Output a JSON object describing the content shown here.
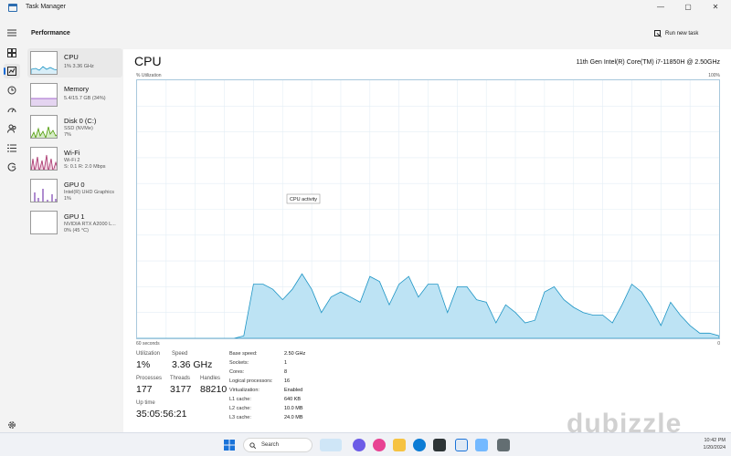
{
  "window": {
    "title": "Task Manager",
    "minimize_glyph": "—",
    "maximize_glyph": "▢",
    "close_glyph": "✕"
  },
  "header": {
    "page_title": "Performance",
    "run_task_label": "Run new task",
    "more_label": "···"
  },
  "devices": [
    {
      "name": "CPU",
      "sub1": "1% 3.36 GHz",
      "sub2": "",
      "color": "#1c94c4"
    },
    {
      "name": "Memory",
      "sub1": "5.4/15.7 GB (34%)",
      "sub2": "",
      "color": "#8b3fbf"
    },
    {
      "name": "Disk 0 (C:)",
      "sub1": "SSD (NVMe)",
      "sub2": "7%",
      "color": "#4e9a06"
    },
    {
      "name": "Wi-Fi",
      "sub1": "Wi-Fi 2",
      "sub2": "S: 0.1 R: 2.0 Mbps",
      "color": "#a62d67"
    },
    {
      "name": "GPU 0",
      "sub1": "Intel(R) UHD Graphics",
      "sub2": "1%",
      "color": "#7a3fb0"
    },
    {
      "name": "GPU 1",
      "sub1": "NVIDIA RTX A2000 L...",
      "sub2": "0% (45 °C)",
      "color": "#7a3fb0"
    }
  ],
  "cpu": {
    "title": "CPU",
    "model": "11th Gen Intel(R) Core(TM) i7-11850H @ 2.50GHz",
    "util_label": "% Utilization",
    "max_label": "100%",
    "time_label": "60 seconds",
    "min_label": "0",
    "tooltip": "CPU activity"
  },
  "stats": {
    "utilization_label": "Utilization",
    "utilization_value": "1%",
    "speed_label": "Speed",
    "speed_value": "3.36 GHz",
    "processes_label": "Processes",
    "processes_value": "177",
    "threads_label": "Threads",
    "threads_value": "3177",
    "handles_label": "Handles",
    "handles_value": "88210",
    "uptime_label": "Up time",
    "uptime_value": "35:05:56:21"
  },
  "specs": [
    {
      "label": "Base speed:",
      "value": "2.50 GHz"
    },
    {
      "label": "Sockets:",
      "value": "1"
    },
    {
      "label": "Cores:",
      "value": "8"
    },
    {
      "label": "Logical processors:",
      "value": "16"
    },
    {
      "label": "Virtualization:",
      "value": "Enabled"
    },
    {
      "label": "L1 cache:",
      "value": "640 KB"
    },
    {
      "label": "L2 cache:",
      "value": "10.0 MB"
    },
    {
      "label": "L3 cache:",
      "value": "24.0 MB"
    }
  ],
  "taskbar": {
    "search_placeholder": "Search",
    "time": "10:42 PM",
    "date": "1/20/2024"
  },
  "watermark": "dubizzle",
  "chart_data": {
    "type": "area",
    "ylim": [
      0,
      100
    ],
    "x": [
      0,
      1,
      2,
      3,
      4,
      5,
      6,
      7,
      8,
      9,
      10,
      11,
      12,
      13,
      14,
      15,
      16,
      17,
      18,
      19,
      20,
      21,
      22,
      23,
      24,
      25,
      26,
      27,
      28,
      29,
      30,
      31,
      32,
      33,
      34,
      35,
      36,
      37,
      38,
      39,
      40,
      41,
      42,
      43,
      44,
      45,
      46,
      47,
      48,
      49,
      50,
      51,
      52,
      53,
      54,
      55,
      56,
      57,
      58,
      59,
      60
    ],
    "values": [
      0,
      0,
      0,
      0,
      0,
      0,
      0,
      0,
      0,
      0,
      0,
      1,
      21,
      21,
      19,
      15,
      19,
      25,
      19,
      10,
      16,
      18,
      16,
      14,
      24,
      22,
      13,
      21,
      24,
      16,
      21,
      21,
      10,
      20,
      20,
      15,
      14,
      6,
      13,
      10,
      6,
      7,
      18,
      20,
      15,
      12,
      10,
      9,
      9,
      6,
      13,
      21,
      18,
      12,
      5,
      14,
      9,
      5,
      2,
      2,
      1
    ],
    "color": "#1c94c4"
  }
}
